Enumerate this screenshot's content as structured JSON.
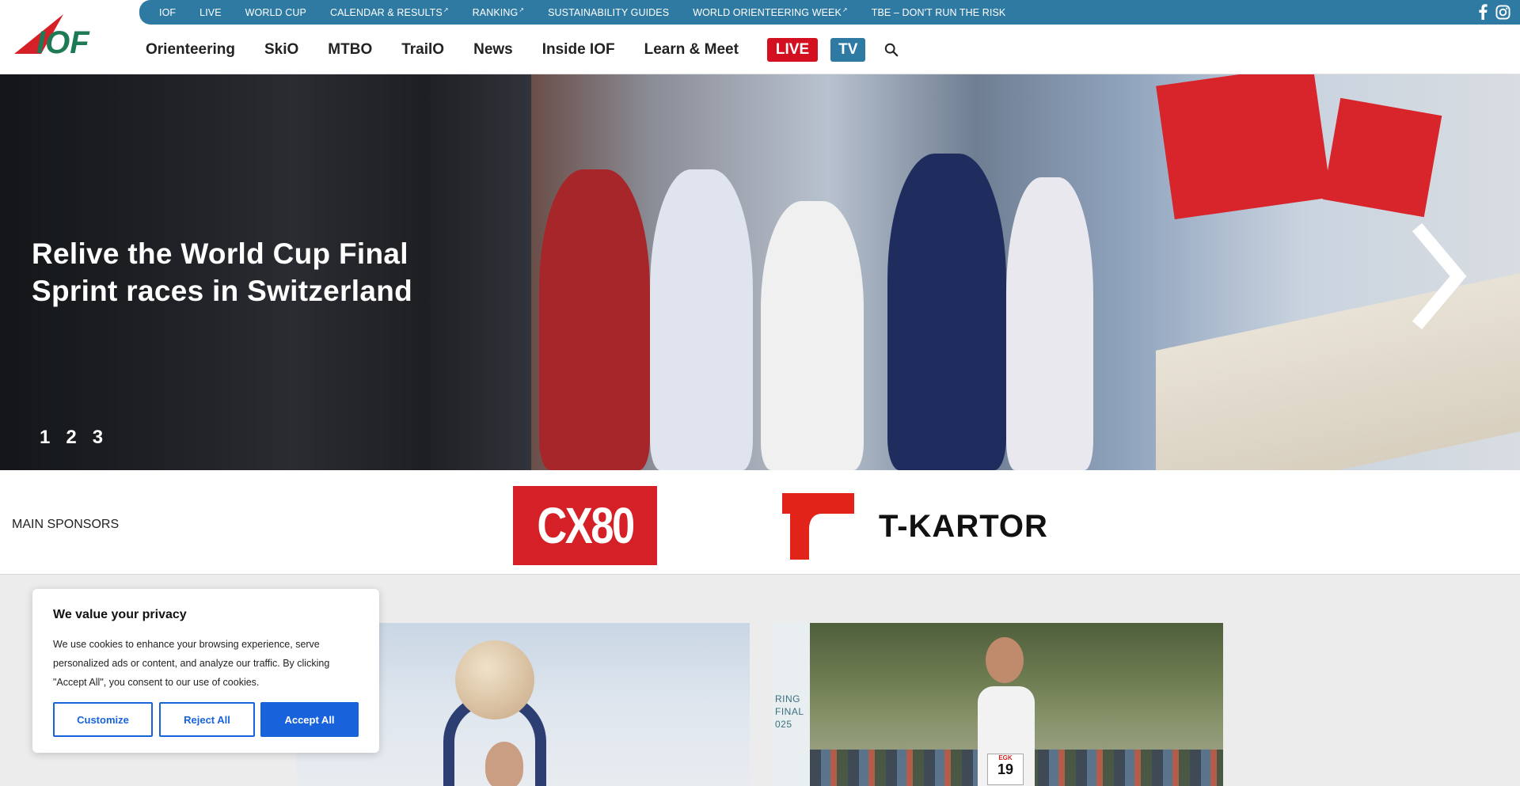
{
  "topbar": {
    "links": [
      {
        "label": "IOF",
        "external": false
      },
      {
        "label": "LIVE",
        "external": false
      },
      {
        "label": "WORLD CUP",
        "external": false
      },
      {
        "label": "CALENDAR & RESULTS",
        "external": true
      },
      {
        "label": "RANKING",
        "external": true
      },
      {
        "label": "SUSTAINABILITY GUIDES",
        "external": false
      },
      {
        "label": "WORLD ORIENTEERING WEEK",
        "external": true
      },
      {
        "label": "TBE – DON'T RUN THE RISK",
        "external": false
      }
    ],
    "social": [
      "facebook-icon",
      "instagram-icon"
    ],
    "color": "#2f7aa2"
  },
  "nav": {
    "items": [
      "Orienteering",
      "SkiO",
      "MTBO",
      "TrailO",
      "News",
      "Inside IOF",
      "Learn & Meet"
    ],
    "live_label": "LIVE",
    "tv_label": "TV",
    "live_color": "#d3101f",
    "tv_color": "#2f7aa2"
  },
  "hero": {
    "title": "Relive the World Cup Final Sprint races in Switzerland",
    "slides": [
      "1",
      "2",
      "3"
    ],
    "next_icon": "chevron-right-icon"
  },
  "sponsors": {
    "label": "MAIN SPONSORS",
    "logos": [
      {
        "name": "CX80",
        "text": "CX80",
        "color": "#d52027"
      },
      {
        "name": "T-Kartor",
        "text": "T-KARTOR",
        "color": "#e2231a"
      }
    ]
  },
  "cards": {
    "card2_sign": [
      "RING",
      "FINAL",
      "025"
    ],
    "card2_bib": "19",
    "card2_bib_top": "EGK"
  },
  "cookie": {
    "title": "We value your privacy",
    "body": "We use cookies to enhance your browsing experience, serve personalized ads or content, and analyze our traffic. By clicking \"Accept All\", you consent to our use of cookies.",
    "buttons": {
      "customize": "Customize",
      "reject": "Reject All",
      "accept": "Accept All"
    },
    "accent": "#1863dc"
  }
}
